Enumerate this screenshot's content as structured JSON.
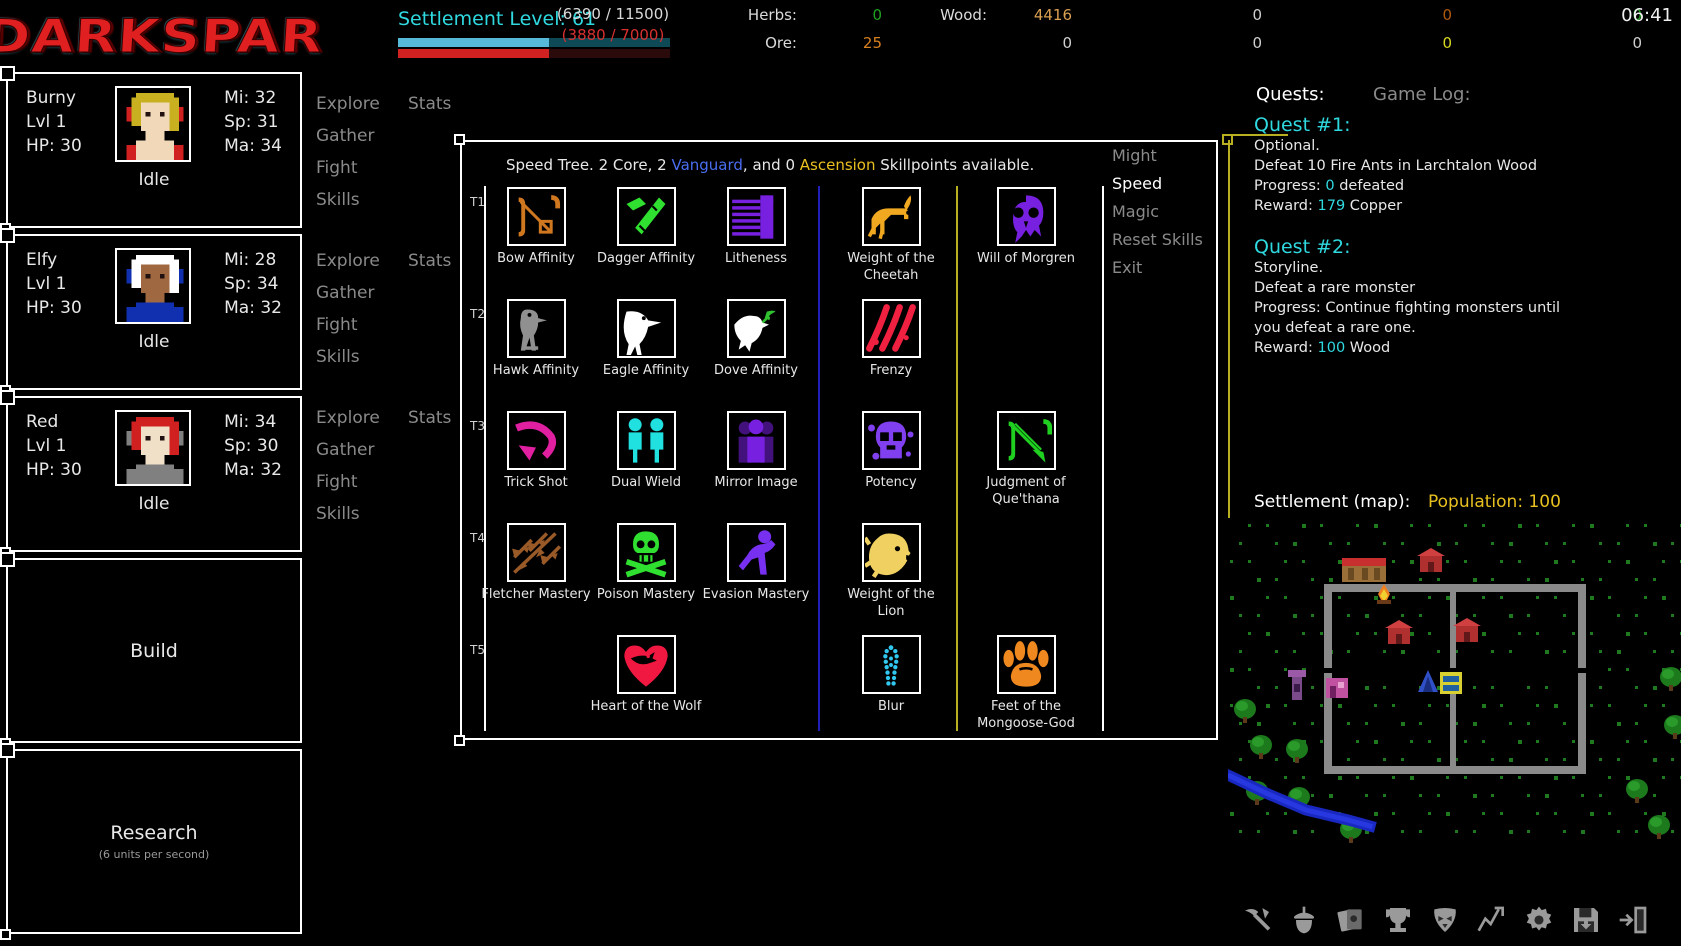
{
  "logo": {
    "text": "DARKSPAR"
  },
  "topbar": {
    "settlement_label": "Settlement Level: 61",
    "bar_primary": {
      "current": 6390,
      "max": 11500,
      "text": "(6390 / 11500)",
      "percent": 55.6,
      "color": "#56b9d8"
    },
    "bar_secondary": {
      "current": 3880,
      "max": 7000,
      "text": "(3880 / 7000)",
      "percent": 55.4,
      "color": "#d22121"
    },
    "clock": "06:41",
    "resources": [
      {
        "name": "Herbs:",
        "value": "0",
        "color": "#20a020"
      },
      {
        "name": "Ore:",
        "value": "25",
        "color": "#d88020"
      },
      {
        "name": "Wood:",
        "value": "4416",
        "color": "#d8a050"
      },
      {
        "name": "",
        "value": "0",
        "color": "#d0d0d0"
      },
      {
        "name": "",
        "value": "0",
        "color": "#b05a10"
      },
      {
        "name": "",
        "value": "0",
        "color": "#d8d820"
      },
      {
        "name": "",
        "value": "0",
        "color": "#20a020"
      },
      {
        "name": "",
        "value": "0",
        "color": "#d0d0d0"
      }
    ],
    "res_columns": [
      {
        "rows": [
          {
            "name": "Herbs:",
            "value": "0",
            "color": "#20a020"
          },
          {
            "name": "Ore:",
            "value": "25",
            "color": "#d88020"
          }
        ]
      },
      {
        "rows": [
          {
            "name": "Wood:",
            "value": "4416",
            "color": "#d8a050"
          },
          {
            "name": "",
            "value": "0",
            "color": "#d0d0d0"
          }
        ]
      },
      {
        "rows": [
          {
            "name": "",
            "value": "0",
            "color": "#d0d0d0"
          },
          {
            "name": "",
            "value": "0",
            "color": "#d0d0d0"
          }
        ]
      },
      {
        "rows": [
          {
            "name": "",
            "value": "0",
            "color": "#b05a10"
          },
          {
            "name": "",
            "value": "0",
            "color": "#d8d820"
          }
        ]
      },
      {
        "rows": [
          {
            "name": "",
            "value": "0",
            "color": "#20a020"
          },
          {
            "name": "",
            "value": "0",
            "color": "#d0d0d0"
          }
        ]
      }
    ]
  },
  "characters": [
    {
      "name": "Burny",
      "level": "Lvl 1",
      "hp": "HP: 30",
      "mi": "Mi: 32",
      "sp": "Sp: 31",
      "ma": "Ma: 34",
      "status": "Idle",
      "portrait": {
        "hair": "#c8b020",
        "skin": "#f0d8b8",
        "accent": "#d02020",
        "cloth": "#f0d8b8"
      }
    },
    {
      "name": "Elfy",
      "level": "Lvl 1",
      "hp": "HP: 30",
      "mi": "Mi: 28",
      "sp": "Sp: 34",
      "ma": "Ma: 32",
      "status": "Idle",
      "portrait": {
        "hair": "#ffffff",
        "skin": "#a06840",
        "accent": "#1030b0",
        "cloth": "#1030b0"
      }
    },
    {
      "name": "Red",
      "level": "Lvl 1",
      "hp": "HP: 30",
      "mi": "Mi: 34",
      "sp": "Sp: 30",
      "ma": "Ma: 32",
      "status": "Idle",
      "portrait": {
        "hair": "#d02020",
        "skin": "#f0e0c8",
        "accent": "#808080",
        "cloth": "#808080"
      }
    }
  ],
  "menu": {
    "items": [
      "Explore",
      "Gather",
      "Fight",
      "Skills"
    ],
    "stats_label": "Stats"
  },
  "actions": {
    "build": {
      "title": "Build",
      "sub": ""
    },
    "research": {
      "title": "Research",
      "sub": "(6 units per second)"
    }
  },
  "skilltree": {
    "header_pre": "Speed Tree. 2 Core, 2 ",
    "header_vanguard": "Vanguard",
    "header_mid": ", and 0 ",
    "header_ascension": "Ascension",
    "header_post": " Skillpoints available.",
    "tiers": [
      "T1",
      "T2",
      "T3",
      "T4",
      "T5"
    ],
    "skills": [
      {
        "name": "Bow Affinity",
        "icon": "bow-icon",
        "color": "#d07820",
        "tier": 0,
        "col": 0
      },
      {
        "name": "Dagger Affinity",
        "icon": "dagger-icon",
        "color": "#30e030",
        "tier": 0,
        "col": 1
      },
      {
        "name": "Litheness",
        "icon": "litheness-icon",
        "color": "#7820e0",
        "tier": 0,
        "col": 2
      },
      {
        "name": "Weight of the Cheetah",
        "icon": "cheetah-icon",
        "color": "#f0a820",
        "tier": 0,
        "col": 3
      },
      {
        "name": "Will of Morgren",
        "icon": "skull-icon",
        "color": "#7820e0",
        "tier": 0,
        "col": 4
      },
      {
        "name": "Hawk Affinity",
        "icon": "hawk-icon",
        "color": "#909090",
        "tier": 1,
        "col": 0
      },
      {
        "name": "Eagle Affinity",
        "icon": "eagle-icon",
        "color": "#ffffff",
        "tier": 1,
        "col": 1
      },
      {
        "name": "Dove Affinity",
        "icon": "dove-icon",
        "color": "#ffffff",
        "tier": 1,
        "col": 2
      },
      {
        "name": "Frenzy",
        "icon": "frenzy-icon",
        "color": "#f02040",
        "tier": 1,
        "col": 3
      },
      {
        "name": "Trick Shot",
        "icon": "trickshot-icon",
        "color": "#e020a0",
        "tier": 2,
        "col": 0
      },
      {
        "name": "Dual Wield",
        "icon": "dualwield-icon",
        "color": "#20e0e0",
        "tier": 2,
        "col": 1
      },
      {
        "name": "Mirror Image",
        "icon": "mirror-icon",
        "color": "#7820e0",
        "tier": 2,
        "col": 2
      },
      {
        "name": "Potency",
        "icon": "potency-icon",
        "color": "#8040f0",
        "tier": 2,
        "col": 3
      },
      {
        "name": "Judgment of Que'thana",
        "icon": "greenbow-icon",
        "color": "#20d020",
        "tier": 2,
        "col": 4
      },
      {
        "name": "Fletcher Mastery",
        "icon": "arrows-icon",
        "color": "#9a5a28",
        "tier": 3,
        "col": 0
      },
      {
        "name": "Poison Mastery",
        "icon": "poison-icon",
        "color": "#30e030",
        "tier": 3,
        "col": 1
      },
      {
        "name": "Evasion Mastery",
        "icon": "evasion-icon",
        "color": "#7830f0",
        "tier": 3,
        "col": 2
      },
      {
        "name": "Weight of the Lion",
        "icon": "lion-icon",
        "color": "#f0d060",
        "tier": 3,
        "col": 3
      },
      {
        "name": "Heart of the Wolf",
        "icon": "heart-icon",
        "color": "#f01840",
        "tier": 4,
        "col": 1
      },
      {
        "name": "Blur",
        "icon": "blur-icon",
        "color": "#30c8f0",
        "tier": 4,
        "col": 3
      },
      {
        "name": "Feet of the Mongoose-God",
        "icon": "paw-icon",
        "color": "#f08820",
        "tier": 4,
        "col": 4
      }
    ],
    "side_menu": [
      {
        "label": "Might",
        "active": false
      },
      {
        "label": "Speed",
        "active": true
      },
      {
        "label": "Magic",
        "active": false
      },
      {
        "label": "Reset Skills",
        "active": false
      },
      {
        "label": "Exit",
        "active": false
      }
    ]
  },
  "right": {
    "quests_tab": "Quests:",
    "gamelog_tab": "Game Log:",
    "quests": [
      {
        "title": "Quest #1:",
        "lines": [
          [
            {
              "t": "Optional."
            }
          ],
          [
            {
              "t": "Defeat 10 Fire Ants in Larchtalon Wood"
            }
          ],
          [
            {
              "t": "Progress: "
            },
            {
              "t": "0",
              "hl": true
            },
            {
              "t": " defeated"
            }
          ],
          [
            {
              "t": "Reward: "
            },
            {
              "t": "179",
              "hl": true
            },
            {
              "t": " Copper"
            }
          ]
        ]
      },
      {
        "title": "Quest #2:",
        "lines": [
          [
            {
              "t": "Storyline."
            }
          ],
          [
            {
              "t": "Defeat a rare monster"
            }
          ],
          [
            {
              "t": "Progress: Continue fighting monsters until"
            }
          ],
          [
            {
              "t": "you defeat a rare one."
            }
          ],
          [
            {
              "t": "Reward: "
            },
            {
              "t": "100",
              "hl": true
            },
            {
              "t": " Wood"
            }
          ]
        ]
      }
    ],
    "map_label": "Settlement (map):",
    "population_label": "Population: 100",
    "toolbar_icons": [
      "pickaxe-icon",
      "acorn-icon",
      "cards-icon",
      "trophy-icon",
      "demon-mask-icon",
      "chart-icon",
      "gear-icon",
      "save-icon",
      "exit-icon"
    ]
  }
}
